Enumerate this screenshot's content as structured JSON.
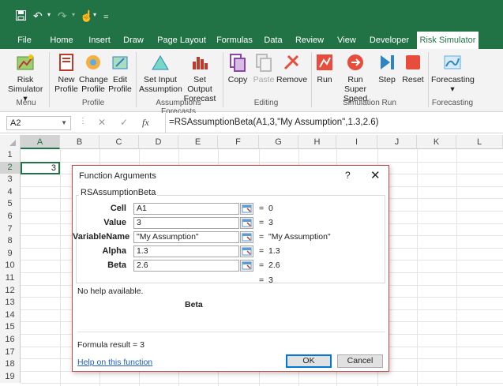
{
  "quick_access": {
    "save_icon": "save-icon",
    "undo_icon": "undo-icon",
    "redo_icon": "redo-icon",
    "touch_icon": "touch-mode-icon",
    "customize": "="
  },
  "tabs": [
    "File",
    "Home",
    "Insert",
    "Draw",
    "Page Layout",
    "Formulas",
    "Data",
    "Review",
    "View",
    "Developer",
    "Risk Simulator"
  ],
  "ribbon": {
    "menu": {
      "label1": "Risk",
      "label2": "Simulator",
      "group": "Menu"
    },
    "profile": {
      "new1": "New",
      "new2": "Profile",
      "change1": "Change",
      "change2": "Profile",
      "edit1": "Edit",
      "edit2": "Profile",
      "group": "Profile"
    },
    "assumptions": {
      "setinput1": "Set Input",
      "setinput2": "Assumption",
      "setoutput1": "Set Output",
      "setoutput2": "Forecast",
      "group": "Assumptions Forecasts"
    },
    "editing": {
      "copy": "Copy",
      "paste": "Paste",
      "remove": "Remove",
      "group": "Editing"
    },
    "simulation": {
      "run": "Run",
      "runsuper1": "Run Super",
      "runsuper2": "Speed",
      "step": "Step",
      "reset": "Reset",
      "group": "Simulation Run"
    },
    "forecasting": {
      "label": "Forecasting",
      "group": "Forecasting"
    }
  },
  "formula_bar": {
    "name_box": "A2",
    "cancel": "✕",
    "enter": "✓",
    "fx": "fx",
    "formula": "=RSAssumptionBeta(A1,3,\"My Assumption\",1.3,2.6)"
  },
  "grid": {
    "columns": [
      "A",
      "B",
      "C",
      "D",
      "E",
      "F",
      "G",
      "H",
      "I",
      "J",
      "K",
      "L"
    ],
    "rows": [
      "1",
      "2",
      "3",
      "4",
      "5",
      "6",
      "7",
      "8",
      "9",
      "10",
      "11",
      "12",
      "13",
      "14",
      "15",
      "16",
      "17",
      "18",
      "19"
    ],
    "a2_value": "3"
  },
  "dialog": {
    "title": "Function Arguments",
    "help": "?",
    "close": "✕",
    "function_name": "RSAssumptionBeta",
    "params": [
      {
        "label": "Cell",
        "input": "A1",
        "result": "0"
      },
      {
        "label": "Value",
        "input": "3",
        "result": "3"
      },
      {
        "label": "VariableName",
        "input": "\"My Assumption\"",
        "result": "\"My Assumption\""
      },
      {
        "label": "Alpha",
        "input": "1.3",
        "result": "1.3"
      },
      {
        "label": "Beta",
        "input": "2.6",
        "result": "2.6"
      }
    ],
    "equals": "=",
    "overall_result": "3",
    "description": "No help available.",
    "arg_name": "Beta",
    "formula_result": "Formula result =   3",
    "help_link": "Help on this function",
    "ok": "OK",
    "cancel": "Cancel"
  }
}
